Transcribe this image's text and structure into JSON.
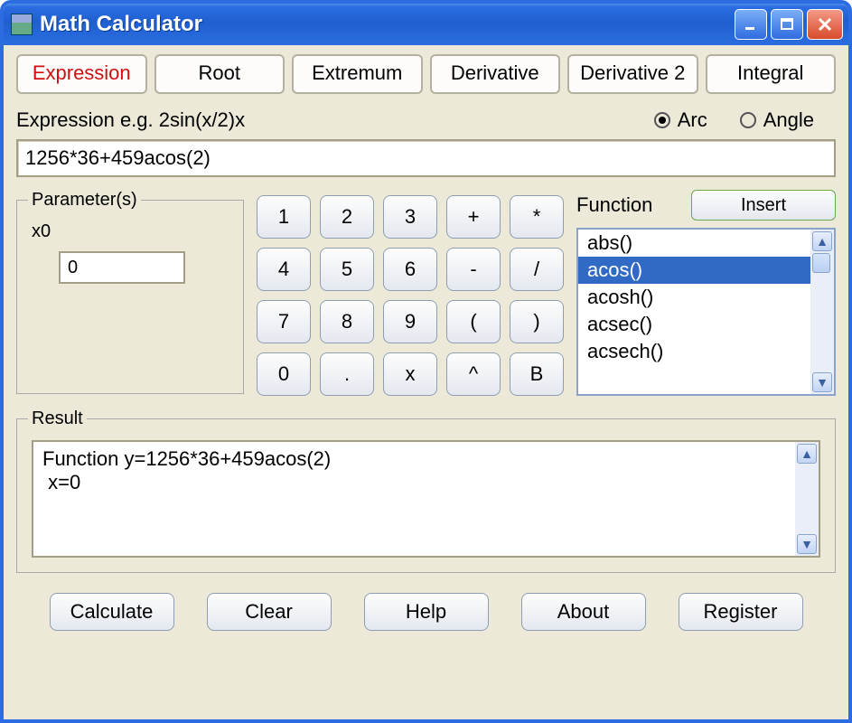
{
  "window": {
    "title": "Math Calculator"
  },
  "tabs": [
    {
      "label": "Expression",
      "active": true
    },
    {
      "label": "Root"
    },
    {
      "label": "Extremum"
    },
    {
      "label": "Derivative"
    },
    {
      "label": "Derivative 2"
    },
    {
      "label": "Integral"
    }
  ],
  "expression": {
    "hint_label": "Expression  e.g. 2sin(x/2)x",
    "value": "1256*36+459acos(2)"
  },
  "mode": {
    "arc_label": "Arc",
    "angle_label": "Angle",
    "selected": "arc"
  },
  "parameters": {
    "legend": "Parameter(s)",
    "name": "x0",
    "value": "0"
  },
  "keypad": [
    "1",
    "2",
    "3",
    "+",
    "*",
    "4",
    "5",
    "6",
    "-",
    "/",
    "7",
    "8",
    "9",
    "(",
    ")",
    "0",
    ".",
    "x",
    "^",
    "B"
  ],
  "functions": {
    "label": "Function",
    "insert_label": "Insert",
    "items": [
      "abs()",
      "acos()",
      "acosh()",
      "acsec()",
      "acsech()"
    ],
    "selected_index": 1
  },
  "result": {
    "legend": "Result",
    "text": "Function y=1256*36+459acos(2)\n x=0"
  },
  "buttons": {
    "calculate": "Calculate",
    "clear": "Clear",
    "help": "Help",
    "about": "About",
    "register": "Register"
  }
}
